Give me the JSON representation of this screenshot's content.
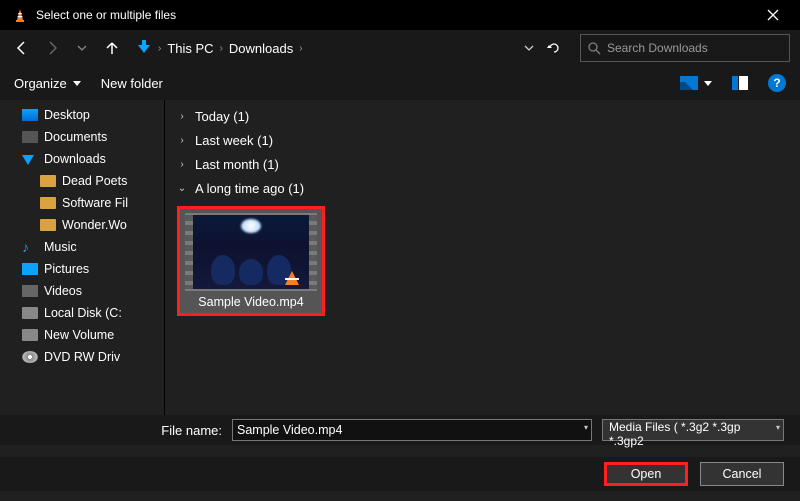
{
  "titlebar": {
    "title": "Select one or multiple files"
  },
  "breadcrumb": {
    "root": "This PC",
    "folder": "Downloads"
  },
  "search": {
    "placeholder": "Search Downloads"
  },
  "toolbar": {
    "organize": "Organize",
    "new_folder": "New folder"
  },
  "sidebar": {
    "items": [
      {
        "label": "Desktop"
      },
      {
        "label": "Documents"
      },
      {
        "label": "Downloads"
      },
      {
        "label": "Dead Poets"
      },
      {
        "label": "Software Fil"
      },
      {
        "label": "Wonder.Wo"
      },
      {
        "label": "Music"
      },
      {
        "label": "Pictures"
      },
      {
        "label": "Videos"
      },
      {
        "label": "Local Disk (C:"
      },
      {
        "label": "New Volume"
      },
      {
        "label": "DVD RW Driv"
      }
    ]
  },
  "groups": {
    "g0": {
      "label": "Today (1)"
    },
    "g1": {
      "label": "Last week (1)"
    },
    "g2": {
      "label": "Last month (1)"
    },
    "g3": {
      "label": "A long time ago (1)"
    }
  },
  "file": {
    "label": "Sample Video.mp4"
  },
  "filename": {
    "label": "File name:",
    "value": "Sample Video.mp4"
  },
  "filetype": {
    "label": "Media Files ( *.3g2 *.3gp *.3gp2"
  },
  "buttons": {
    "open": "Open",
    "cancel": "Cancel"
  },
  "help": {
    "q": "?"
  }
}
